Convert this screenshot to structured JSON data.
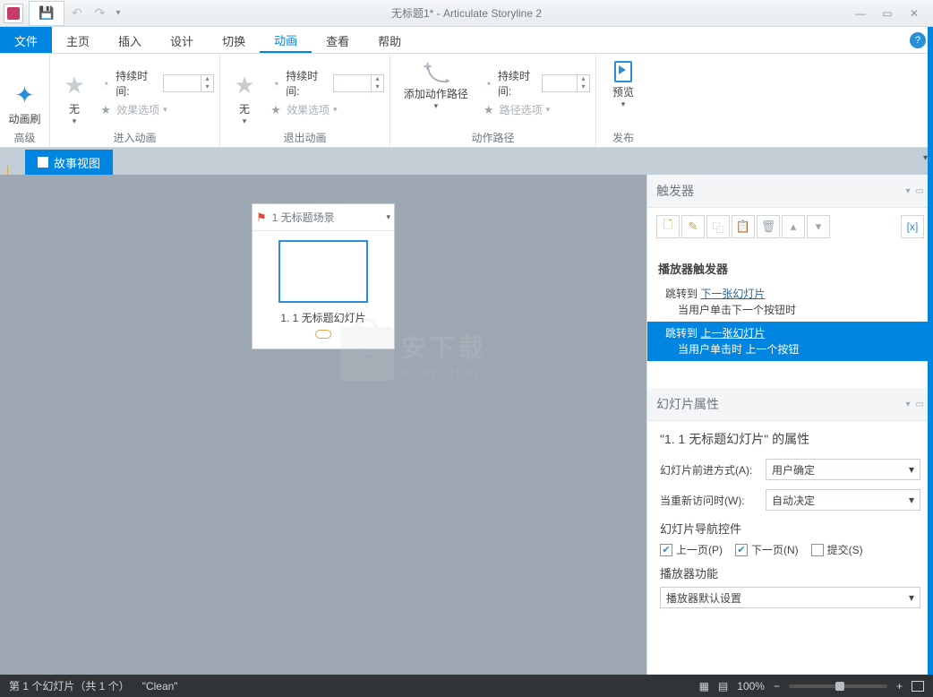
{
  "title": "无标题1* - Articulate Storyline 2",
  "qat": {
    "undo": "↶",
    "redo": "↷",
    "dd": "▾"
  },
  "winbtns": {
    "min": "—",
    "max": "▭",
    "close": "✕"
  },
  "menu": {
    "file": "文件",
    "home": "主页",
    "insert": "插入",
    "design": "设计",
    "transition": "切换",
    "animation": "动画",
    "view": "查看",
    "help": "帮助"
  },
  "ribbon": {
    "group1": {
      "brush": "动画刷",
      "label": "高级"
    },
    "dur_label": "持续时间:",
    "none": "无",
    "effect": "效果选项",
    "group2": "进入动画",
    "group3": "退出动画",
    "group4_btn": "添加动作路径",
    "group4_pathopt": "路径选项",
    "group4": "动作路径",
    "group5_preview": "预览",
    "group5": "发布"
  },
  "tab": {
    "story": "故事视图"
  },
  "scene": {
    "title": "1 无标题场景",
    "slide": "1. 1 无标题幻灯片"
  },
  "wm": {
    "top": "安下载",
    "bot": "anxz.com"
  },
  "panel1": {
    "title": "触发器",
    "tb": {
      "new": "🗋",
      "edit": "✎",
      "copy": "⿻",
      "paste": "📋",
      "del": "🗑",
      "up": "▴",
      "down": "▾",
      "vars": "[x]"
    },
    "section": "播放器触发器",
    "r1a": "跳转到 ",
    "r1b": "下一张幻灯片",
    "r1c": "当用户单击下一个按钮时",
    "r2a": "跳转到 ",
    "r2b": "上一张幻灯片",
    "r2c": "当用户单击时 上一个按钮"
  },
  "panel2": {
    "title": "幻灯片属性",
    "slideof": "\"1. 1 无标题幻灯片\" 的属性",
    "advlabel": "幻灯片前进方式(A):",
    "advval": "用户确定",
    "revlabel": "当重新访问时(W):",
    "revval": "自动决定",
    "navctrls": "幻灯片导航控件",
    "prev": "上一页(P)",
    "next": "下一页(N)",
    "submit": "提交(S)",
    "playerfeat": "播放器功能",
    "playerdef": "播放器默认设置"
  },
  "status": {
    "left1": "第 1 个幻灯片（共 1 个）",
    "left2": "\"Clean\"",
    "zoom": "100%"
  }
}
